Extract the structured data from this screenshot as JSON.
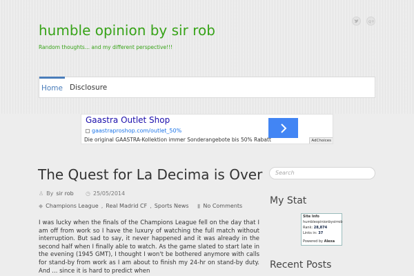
{
  "site": {
    "title": "humble opinion by sir rob",
    "description": "Random thoughts... and my different perspective!!!"
  },
  "social": [
    "twitter-icon",
    "google-plus-icon"
  ],
  "nav": {
    "items": [
      "Home",
      "Disclosure"
    ]
  },
  "ad": {
    "title": "Gaastra Outlet Shop",
    "url": "gaastraproshop.com/outlet_50%",
    "description": "Die original GAASTRA-Kollektion immer Sonderangebote bis 50% Rabatt",
    "choices": "AdChoices",
    "button_color": "#4285f4"
  },
  "post": {
    "title": "The Quest for La Decima is Over",
    "author_prefix": "By",
    "author": "sir rob",
    "date": "25/05/2014",
    "categories": [
      "Champions League",
      "Real Madrid CF",
      "Sports News"
    ],
    "comments": "No Comments",
    "body": "I was lucky when the finals of the Champions League fell on the day that I am off from work so I have the luxury of watching the full match without interruption. But sad to say, it never happened and it was already in the second half when I finally able to watch. As the game slated to start late in the evening (1945 GMT), I thought I won't be bothered anymore with calls for stand-by from work as I am about to finish my 24-hr on stand-by duty. And ... since it is hard to predict when"
  },
  "sidebar": {
    "search_placeholder": "Search",
    "my_stat_title": "My Stat",
    "recent_posts_title": "Recent Posts",
    "alexa": {
      "header": "Site Info",
      "site": "humbleopinionbysirrob",
      "rank_label": "Rank:",
      "rank": "28,874",
      "links_label": "Links in:",
      "links": "37",
      "powered": "Powered by",
      "brand": "Alexa"
    }
  },
  "colors": {
    "accent": "#4a7dba",
    "title_green": "#37a318"
  }
}
